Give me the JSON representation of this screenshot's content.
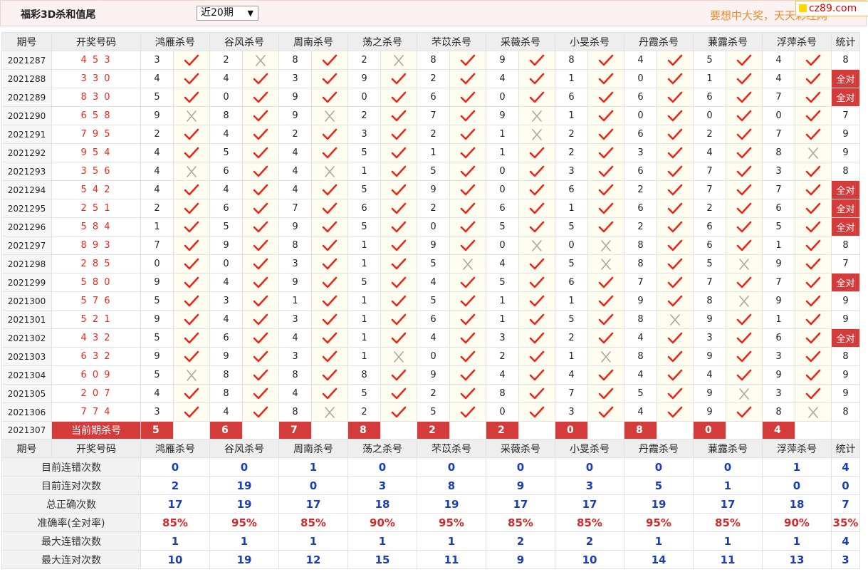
{
  "header": {
    "title": "福彩3D杀和值尾",
    "period_select": "近20期",
    "slogan": "要想中大奖，天天彩经网",
    "logo": "cz89.com"
  },
  "columns": {
    "period": "期号",
    "draw": "开奖号码",
    "experts": [
      "鸿雁杀号",
      "谷风杀号",
      "周南杀号",
      "荡之杀号",
      "芣苡杀号",
      "采薇杀号",
      "小旻杀号",
      "丹霞杀号",
      "蒹露杀号",
      "浮萍杀号"
    ],
    "stat": "统计"
  },
  "rows": [
    {
      "period": "2021287",
      "draw": "4 5 3",
      "kills": [
        "3",
        "2",
        "8",
        "2",
        "8",
        "9",
        "8",
        "4",
        "5",
        "4"
      ],
      "ok": [
        1,
        0,
        1,
        0,
        1,
        1,
        1,
        1,
        1,
        1
      ],
      "stat": "8"
    },
    {
      "period": "2021288",
      "draw": "3 3 0",
      "kills": [
        "4",
        "4",
        "3",
        "9",
        "2",
        "4",
        "1",
        "0",
        "1",
        "4"
      ],
      "ok": [
        1,
        1,
        1,
        1,
        1,
        1,
        1,
        1,
        1,
        1
      ],
      "stat": "全对"
    },
    {
      "period": "2021289",
      "draw": "8 3 0",
      "kills": [
        "5",
        "0",
        "9",
        "0",
        "6",
        "0",
        "6",
        "6",
        "6",
        "7"
      ],
      "ok": [
        1,
        1,
        1,
        1,
        1,
        1,
        1,
        1,
        1,
        1
      ],
      "stat": "全对"
    },
    {
      "period": "2021290",
      "draw": "6 5 8",
      "kills": [
        "9",
        "8",
        "9",
        "2",
        "7",
        "9",
        "1",
        "0",
        "0",
        "0"
      ],
      "ok": [
        0,
        1,
        0,
        1,
        1,
        0,
        1,
        1,
        1,
        1
      ],
      "stat": "7"
    },
    {
      "period": "2021291",
      "draw": "7 9 5",
      "kills": [
        "2",
        "4",
        "2",
        "3",
        "2",
        "1",
        "2",
        "6",
        "2",
        "7"
      ],
      "ok": [
        1,
        1,
        1,
        1,
        1,
        0,
        1,
        1,
        1,
        1
      ],
      "stat": "9"
    },
    {
      "period": "2021292",
      "draw": "9 5 4",
      "kills": [
        "4",
        "5",
        "4",
        "5",
        "1",
        "1",
        "2",
        "3",
        "4",
        "8"
      ],
      "ok": [
        1,
        1,
        1,
        1,
        1,
        1,
        1,
        1,
        1,
        0
      ],
      "stat": "9"
    },
    {
      "period": "2021293",
      "draw": "3 5 6",
      "kills": [
        "4",
        "6",
        "4",
        "1",
        "5",
        "0",
        "3",
        "6",
        "7",
        "3"
      ],
      "ok": [
        0,
        1,
        0,
        1,
        1,
        1,
        1,
        1,
        1,
        1
      ],
      "stat": "8"
    },
    {
      "period": "2021294",
      "draw": "5 4 2",
      "kills": [
        "4",
        "4",
        "4",
        "5",
        "9",
        "0",
        "6",
        "2",
        "7",
        "7"
      ],
      "ok": [
        1,
        1,
        1,
        1,
        1,
        1,
        1,
        1,
        1,
        1
      ],
      "stat": "全对"
    },
    {
      "period": "2021295",
      "draw": "2 5 1",
      "kills": [
        "2",
        "6",
        "7",
        "6",
        "2",
        "6",
        "1",
        "6",
        "2",
        "6"
      ],
      "ok": [
        1,
        1,
        1,
        1,
        1,
        1,
        1,
        1,
        1,
        1
      ],
      "stat": "全对"
    },
    {
      "period": "2021296",
      "draw": "5 8 4",
      "kills": [
        "1",
        "5",
        "9",
        "5",
        "0",
        "5",
        "5",
        "2",
        "6",
        "5"
      ],
      "ok": [
        1,
        1,
        1,
        1,
        1,
        1,
        1,
        1,
        1,
        1
      ],
      "stat": "全对"
    },
    {
      "period": "2021297",
      "draw": "8 9 3",
      "kills": [
        "7",
        "9",
        "8",
        "1",
        "9",
        "0",
        "0",
        "8",
        "6",
        "1"
      ],
      "ok": [
        1,
        1,
        1,
        1,
        1,
        0,
        0,
        1,
        1,
        1
      ],
      "stat": "8"
    },
    {
      "period": "2021298",
      "draw": "2 8 5",
      "kills": [
        "0",
        "0",
        "3",
        "1",
        "5",
        "4",
        "5",
        "8",
        "5",
        "9"
      ],
      "ok": [
        1,
        1,
        1,
        1,
        0,
        1,
        0,
        1,
        0,
        1
      ],
      "stat": "7"
    },
    {
      "period": "2021299",
      "draw": "5 8 0",
      "kills": [
        "9",
        "4",
        "9",
        "5",
        "4",
        "5",
        "6",
        "7",
        "7",
        "7"
      ],
      "ok": [
        1,
        1,
        1,
        1,
        1,
        1,
        1,
        1,
        1,
        1
      ],
      "stat": "全对"
    },
    {
      "period": "2021300",
      "draw": "5 7 6",
      "kills": [
        "5",
        "3",
        "1",
        "1",
        "5",
        "1",
        "1",
        "9",
        "8",
        "9"
      ],
      "ok": [
        1,
        1,
        1,
        1,
        1,
        1,
        1,
        1,
        0,
        1
      ],
      "stat": "9"
    },
    {
      "period": "2021301",
      "draw": "5 2 1",
      "kills": [
        "9",
        "4",
        "3",
        "1",
        "6",
        "1",
        "5",
        "8",
        "9",
        "1"
      ],
      "ok": [
        1,
        1,
        1,
        1,
        1,
        1,
        1,
        0,
        1,
        1
      ],
      "stat": "9"
    },
    {
      "period": "2021302",
      "draw": "4 3 2",
      "kills": [
        "5",
        "6",
        "4",
        "1",
        "4",
        "3",
        "2",
        "4",
        "3",
        "6"
      ],
      "ok": [
        1,
        1,
        1,
        1,
        1,
        1,
        1,
        1,
        1,
        1
      ],
      "stat": "全对"
    },
    {
      "period": "2021303",
      "draw": "6 3 2",
      "kills": [
        "9",
        "9",
        "3",
        "1",
        "0",
        "2",
        "1",
        "8",
        "9",
        "3"
      ],
      "ok": [
        1,
        1,
        1,
        0,
        1,
        1,
        0,
        1,
        1,
        1
      ],
      "stat": "8"
    },
    {
      "period": "2021304",
      "draw": "6 0 9",
      "kills": [
        "5",
        "8",
        "8",
        "8",
        "9",
        "4",
        "4",
        "4",
        "4",
        "9"
      ],
      "ok": [
        0,
        1,
        1,
        1,
        1,
        1,
        1,
        1,
        1,
        1
      ],
      "stat": "9"
    },
    {
      "period": "2021305",
      "draw": "2 0 7",
      "kills": [
        "4",
        "8",
        "4",
        "5",
        "2",
        "8",
        "7",
        "5",
        "9",
        "3"
      ],
      "ok": [
        1,
        1,
        1,
        1,
        1,
        1,
        1,
        1,
        0,
        1
      ],
      "stat": "9"
    },
    {
      "period": "2021306",
      "draw": "7 7 4",
      "kills": [
        "3",
        "4",
        "8",
        "2",
        "5",
        "0",
        "3",
        "4",
        "9",
        "8"
      ],
      "ok": [
        1,
        1,
        0,
        1,
        1,
        1,
        1,
        1,
        1,
        0
      ],
      "stat": "8"
    }
  ],
  "current": {
    "period": "2021307",
    "label": "当前期杀号",
    "kills": [
      "5",
      "6",
      "7",
      "8",
      "2",
      "2",
      "0",
      "8",
      "0",
      "4"
    ]
  },
  "stats": [
    {
      "label": "目前连错次数",
      "values": [
        "0",
        "0",
        "1",
        "0",
        "0",
        "0",
        "0",
        "0",
        "0",
        "1"
      ],
      "stat": "4"
    },
    {
      "label": "目前连对次数",
      "values": [
        "2",
        "19",
        "0",
        "3",
        "8",
        "9",
        "3",
        "5",
        "1",
        "0"
      ],
      "stat": "0"
    },
    {
      "label": "总正确次数",
      "values": [
        "17",
        "19",
        "17",
        "18",
        "19",
        "17",
        "17",
        "19",
        "17",
        "18"
      ],
      "stat": "7"
    },
    {
      "label": "准确率(全对率)",
      "values": [
        "85%",
        "95%",
        "85%",
        "90%",
        "95%",
        "85%",
        "85%",
        "95%",
        "85%",
        "90%"
      ],
      "stat": "35%"
    },
    {
      "label": "最大连错次数",
      "values": [
        "1",
        "1",
        "1",
        "1",
        "1",
        "2",
        "2",
        "1",
        "1",
        "1"
      ],
      "stat": "4"
    },
    {
      "label": "最大连对次数",
      "values": [
        "10",
        "19",
        "12",
        "15",
        "11",
        "9",
        "10",
        "14",
        "11",
        "13"
      ],
      "stat": "3"
    }
  ],
  "icons": {
    "correct": "check-icon",
    "wrong": "cross-icon"
  },
  "colors": {
    "red": "#e8281b",
    "badge": "#d43b3b",
    "blue": "#1a3fb8",
    "slogan": "#f08a2c"
  }
}
